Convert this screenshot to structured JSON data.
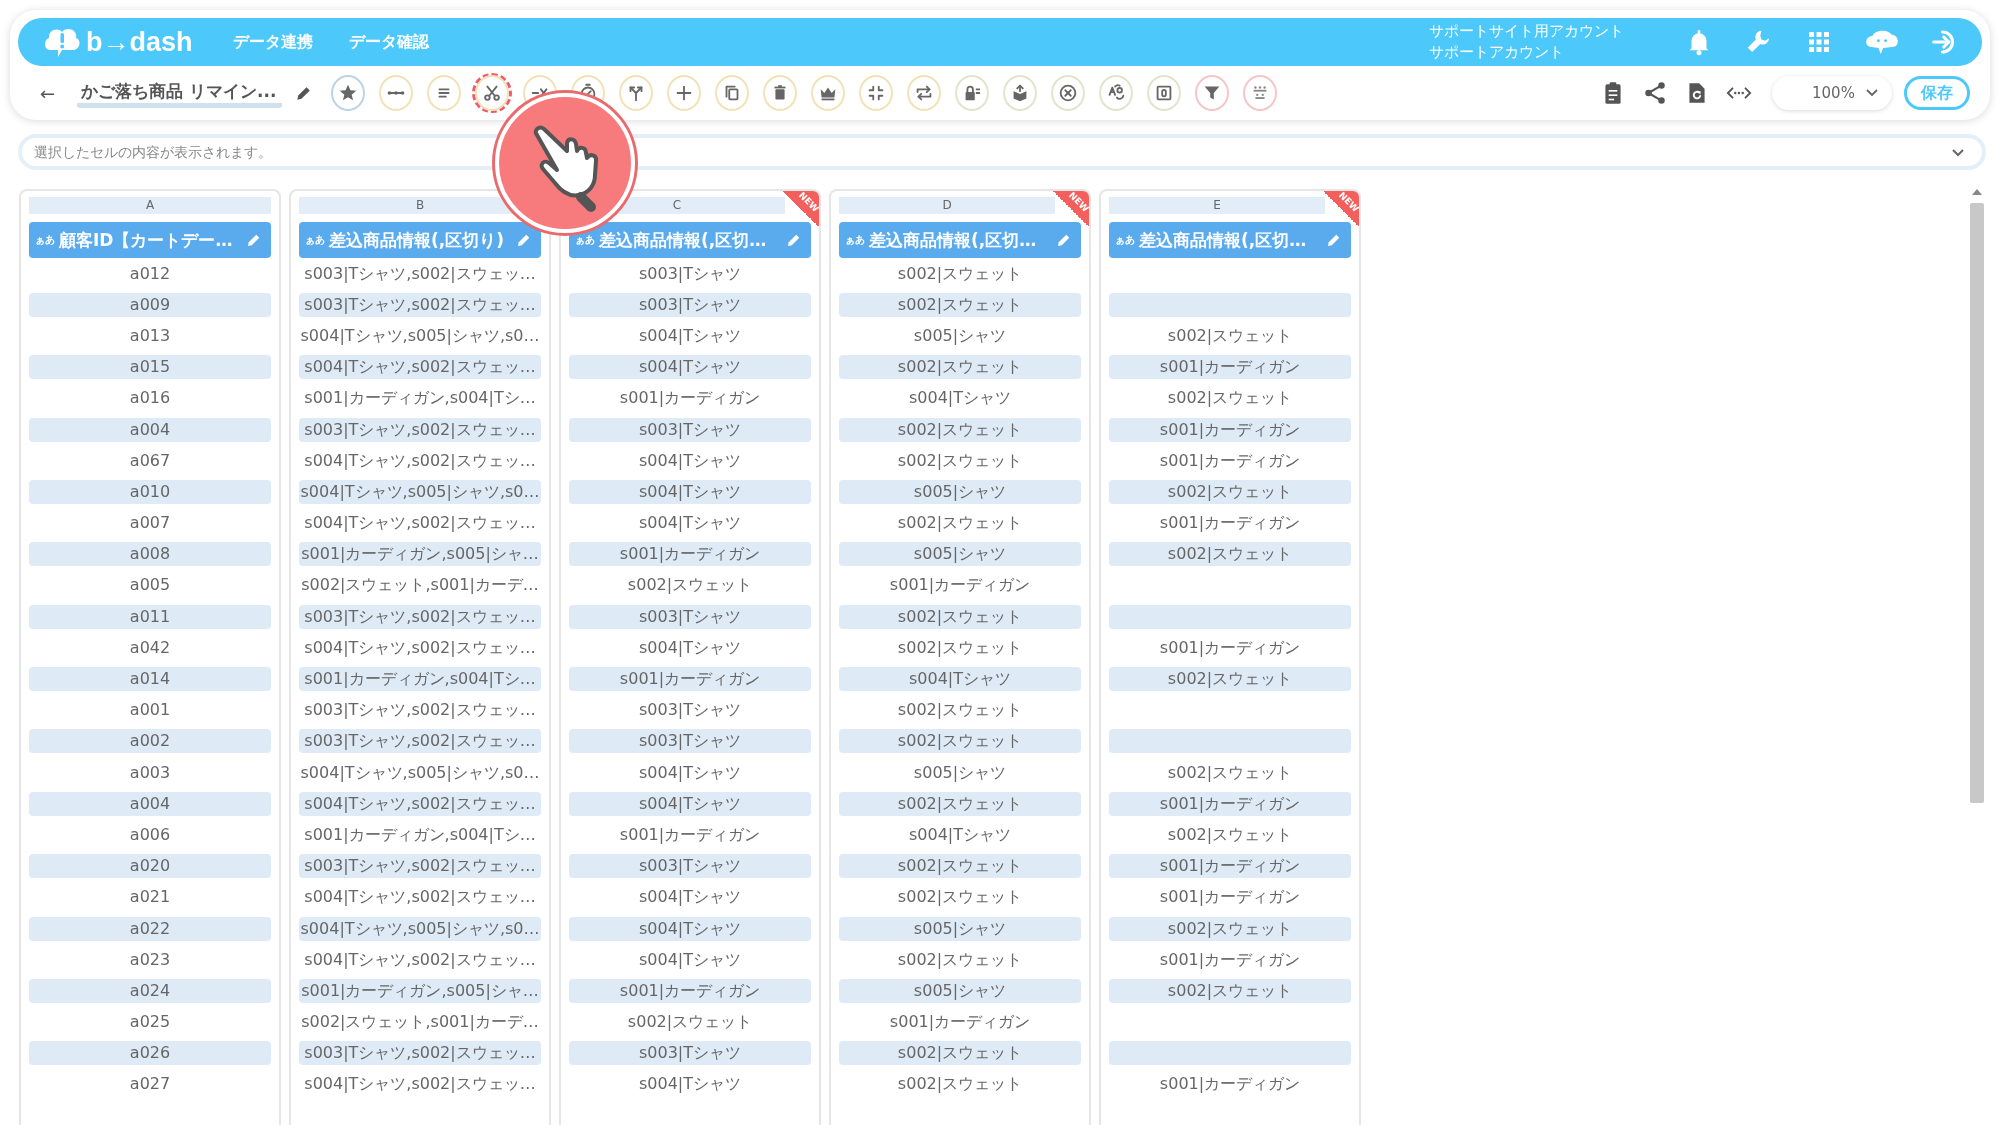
{
  "header": {
    "logo": "b→dash",
    "nav": [
      {
        "label": "データ連携"
      },
      {
        "label": "データ確認"
      }
    ],
    "account": [
      "サポートサイト用アカウント",
      "サポートアカウント"
    ]
  },
  "toolbar": {
    "back": "←",
    "title": "かご落ち商品 リマイン...",
    "tools": [
      {
        "color": "#bcd3e6",
        "highlighted": false
      },
      {
        "color": "#f3e2b8",
        "highlighted": false
      },
      {
        "color": "#f3e2b8",
        "highlighted": false
      },
      {
        "color": "#f3e2b8",
        "highlighted": true
      },
      {
        "color": "#f3e2b8",
        "highlighted": false
      },
      {
        "color": "#f3e2b8",
        "highlighted": false
      },
      {
        "color": "#f3e2b8",
        "highlighted": false
      },
      {
        "color": "#f3e2b8",
        "highlighted": false
      },
      {
        "color": "#f3e2b8",
        "highlighted": false
      },
      {
        "color": "#f3e2b8",
        "highlighted": false
      },
      {
        "color": "#f3e2b8",
        "highlighted": false
      },
      {
        "color": "#f3e2b8",
        "highlighted": false
      },
      {
        "color": "#f3e2b8",
        "highlighted": false
      },
      {
        "color": "#dfe6cc",
        "highlighted": false
      },
      {
        "color": "#dfe6cc",
        "highlighted": false
      },
      {
        "color": "#dfe6cc",
        "highlighted": false
      },
      {
        "color": "#dfe6cc",
        "highlighted": false
      },
      {
        "color": "#dfe6cc",
        "highlighted": false
      },
      {
        "color": "#f6c6c6",
        "highlighted": false
      },
      {
        "color": "#f6c6c6",
        "highlighted": false
      }
    ],
    "zoom": "100%",
    "save": "保存"
  },
  "cell_preview": {
    "placeholder": "選択したセルの内容が表示されます。"
  },
  "table": {
    "columns": [
      {
        "letter": "A",
        "type": "ぁあ",
        "title": "顧客ID【カートデー…"
      },
      {
        "letter": "B",
        "type": "ぁあ",
        "title": "差込商品情報(,区切り)"
      },
      {
        "letter": "C",
        "type": "ぁあ",
        "title": "差込商品情報(,区切…",
        "badge": "NEW"
      },
      {
        "letter": "D",
        "type": "ぁあ",
        "title": "差込商品情報(,区切…",
        "badge": "NEW"
      },
      {
        "letter": "E",
        "type": "ぁあ",
        "title": "差込商品情報(,区切…",
        "badge": "NEW"
      }
    ],
    "rows": [
      [
        "a012",
        "s003|Tシャツ,s002|スウェッ…",
        "s003|Tシャツ",
        "s002|スウェット",
        null
      ],
      [
        "a009",
        "s003|Tシャツ,s002|スウェッ…",
        "s003|Tシャツ",
        "s002|スウェット",
        null
      ],
      [
        "a013",
        "s004|Tシャツ,s005|シャツ,s0…",
        "s004|Tシャツ",
        "s005|シャツ",
        "s002|スウェット"
      ],
      [
        "a015",
        "s004|Tシャツ,s002|スウェッ…",
        "s004|Tシャツ",
        "s002|スウェット",
        "s001|カーディガン"
      ],
      [
        "a016",
        "s001|カーディガン,s004|Tシ…",
        "s001|カーディガン",
        "s004|Tシャツ",
        "s002|スウェット"
      ],
      [
        "a004",
        "s003|Tシャツ,s002|スウェッ…",
        "s003|Tシャツ",
        "s002|スウェット",
        "s001|カーディガン"
      ],
      [
        "a067",
        "s004|Tシャツ,s002|スウェッ…",
        "s004|Tシャツ",
        "s002|スウェット",
        "s001|カーディガン"
      ],
      [
        "a010",
        "s004|Tシャツ,s005|シャツ,s0…",
        "s004|Tシャツ",
        "s005|シャツ",
        "s002|スウェット"
      ],
      [
        "a007",
        "s004|Tシャツ,s002|スウェッ…",
        "s004|Tシャツ",
        "s002|スウェット",
        "s001|カーディガン"
      ],
      [
        "a008",
        "s001|カーディガン,s005|シャ…",
        "s001|カーディガン",
        "s005|シャツ",
        "s002|スウェット"
      ],
      [
        "a005",
        "s002|スウェット,s001|カーデ…",
        "s002|スウェット",
        "s001|カーディガン",
        null
      ],
      [
        "a011",
        "s003|Tシャツ,s002|スウェッ…",
        "s003|Tシャツ",
        "s002|スウェット",
        null
      ],
      [
        "a042",
        "s004|Tシャツ,s002|スウェッ…",
        "s004|Tシャツ",
        "s002|スウェット",
        "s001|カーディガン"
      ],
      [
        "a014",
        "s001|カーディガン,s004|Tシ…",
        "s001|カーディガン",
        "s004|Tシャツ",
        "s002|スウェット"
      ],
      [
        "a001",
        "s003|Tシャツ,s002|スウェッ…",
        "s003|Tシャツ",
        "s002|スウェット",
        null
      ],
      [
        "a002",
        "s003|Tシャツ,s002|スウェッ…",
        "s003|Tシャツ",
        "s002|スウェット",
        null
      ],
      [
        "a003",
        "s004|Tシャツ,s005|シャツ,s0…",
        "s004|Tシャツ",
        "s005|シャツ",
        "s002|スウェット"
      ],
      [
        "a004",
        "s004|Tシャツ,s002|スウェッ…",
        "s004|Tシャツ",
        "s002|スウェット",
        "s001|カーディガン"
      ],
      [
        "a006",
        "s001|カーディガン,s004|Tシ…",
        "s001|カーディガン",
        "s004|Tシャツ",
        "s002|スウェット"
      ],
      [
        "a020",
        "s003|Tシャツ,s002|スウェッ…",
        "s003|Tシャツ",
        "s002|スウェット",
        "s001|カーディガン"
      ],
      [
        "a021",
        "s004|Tシャツ,s002|スウェッ…",
        "s004|Tシャツ",
        "s002|スウェット",
        "s001|カーディガン"
      ],
      [
        "a022",
        "s004|Tシャツ,s005|シャツ,s0…",
        "s004|Tシャツ",
        "s005|シャツ",
        "s002|スウェット"
      ],
      [
        "a023",
        "s004|Tシャツ,s002|スウェッ…",
        "s004|Tシャツ",
        "s002|スウェット",
        "s001|カーディガン"
      ],
      [
        "a024",
        "s001|カーディガン,s005|シャ…",
        "s001|カーディガン",
        "s005|シャツ",
        "s002|スウェット"
      ],
      [
        "a025",
        "s002|スウェット,s001|カーデ…",
        "s002|スウェット",
        "s001|カーディガン",
        null
      ],
      [
        "a026",
        "s003|Tシャツ,s002|スウェッ…",
        "s003|Tシャツ",
        "s002|スウェット",
        null
      ],
      [
        "a027",
        "s004|Tシャツ,s002|スウェッ…",
        "s004|Tシャツ",
        "s002|スウェット",
        "s001|カーディガン"
      ]
    ]
  }
}
